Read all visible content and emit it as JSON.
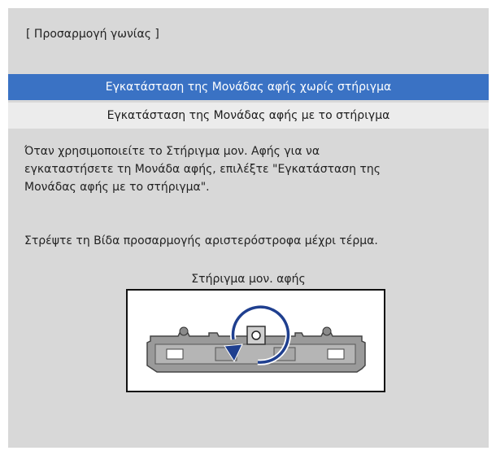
{
  "title": "[ Προσαρμογή γωνίας ]",
  "menu": {
    "items": [
      {
        "label": "Εγκατάσταση της Μονάδας αφής χωρίς στήριγμα",
        "selected": true
      },
      {
        "label": "Εγκατάσταση της Μονάδας αφής με το στήριγμα",
        "selected": false
      }
    ]
  },
  "description": {
    "line1": "Όταν χρησιμοποιείτε το Στήριγμα μον. Αφής για να",
    "line2": "εγκαταστήσετε τη Μονάδα αφής, επιλέξτε \"Εγκατάσταση της",
    "line3": "Μονάδας αφής με το στήριγμα\"."
  },
  "instruction": "Στρέψτε τη Βίδα προσαρμογής αριστερόστροφα μέχρι τέρμα.",
  "figure": {
    "label": "Στήριγμα μον. αφής",
    "icon": "counterclockwise-rotate-arrow-icon"
  },
  "colors": {
    "panel_bg": "#d8d8d8",
    "selected_bg": "#3a72c4",
    "selected_text": "#ffffff",
    "normal_bg": "#ececec"
  }
}
